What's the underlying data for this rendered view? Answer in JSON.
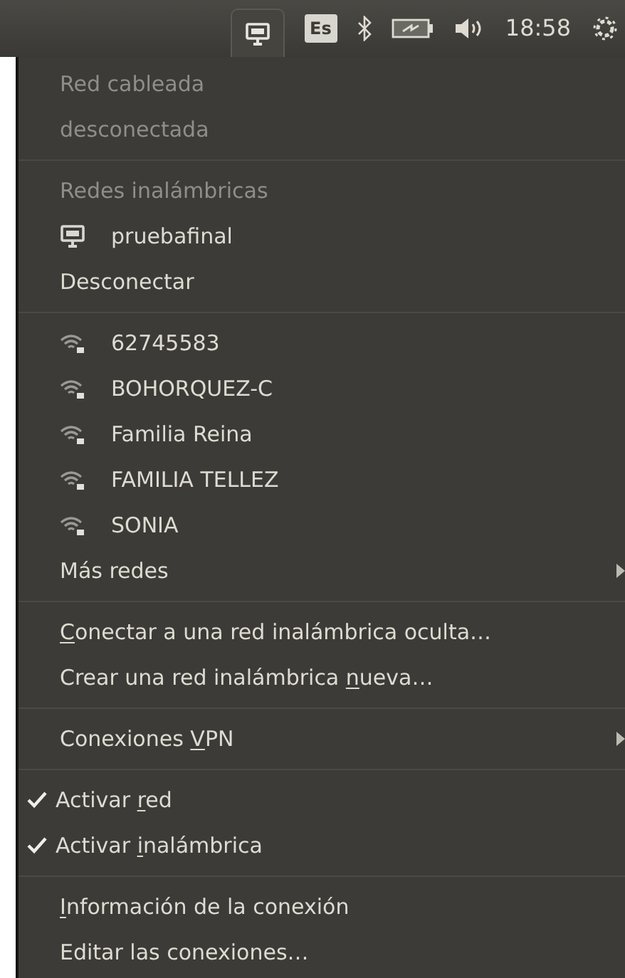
{
  "top_bar": {
    "keyboard_layout": "Es",
    "time": "18:58"
  },
  "menu": {
    "sections": [
      {
        "items": [
          {
            "kind": "header",
            "label": "Red cableada",
            "disabled": true
          },
          {
            "kind": "header",
            "label": "desconectada",
            "disabled": true
          }
        ]
      },
      {
        "items": [
          {
            "kind": "header",
            "label": "Redes inalámbricas",
            "disabled": true
          },
          {
            "kind": "wired_network",
            "label": "pruebafinal"
          },
          {
            "kind": "action",
            "label": "Desconectar"
          }
        ]
      },
      {
        "items": [
          {
            "kind": "wifi_network",
            "label": "62745583"
          },
          {
            "kind": "wifi_network",
            "label": "BOHORQUEZ-C"
          },
          {
            "kind": "wifi_network",
            "label": "Familia Reina"
          },
          {
            "kind": "wifi_network",
            "label": "FAMILIA TELLEZ"
          },
          {
            "kind": "wifi_network",
            "label": "SONIA"
          },
          {
            "kind": "submenu",
            "label": "Más redes"
          }
        ]
      },
      {
        "items": [
          {
            "kind": "action",
            "key": "C",
            "after": "onectar a una red inalámbrica oculta…"
          },
          {
            "kind": "action",
            "before": "Crear una red inalámbrica ",
            "key": "n",
            "after": "ueva…"
          }
        ]
      },
      {
        "items": [
          {
            "kind": "submenu",
            "before": "Conexiones ",
            "key": "V",
            "after": "PN"
          }
        ]
      },
      {
        "items": [
          {
            "kind": "check",
            "checked": true,
            "before": "Activar ",
            "key": "r",
            "after": "ed"
          },
          {
            "kind": "check",
            "checked": true,
            "before": "Activar ",
            "key": "i",
            "after": "nalámbrica"
          }
        ]
      },
      {
        "items": [
          {
            "kind": "action",
            "key": "I",
            "after": "nformación de la conexión"
          },
          {
            "kind": "action",
            "label": "Editar las conexiones…"
          }
        ]
      }
    ]
  }
}
